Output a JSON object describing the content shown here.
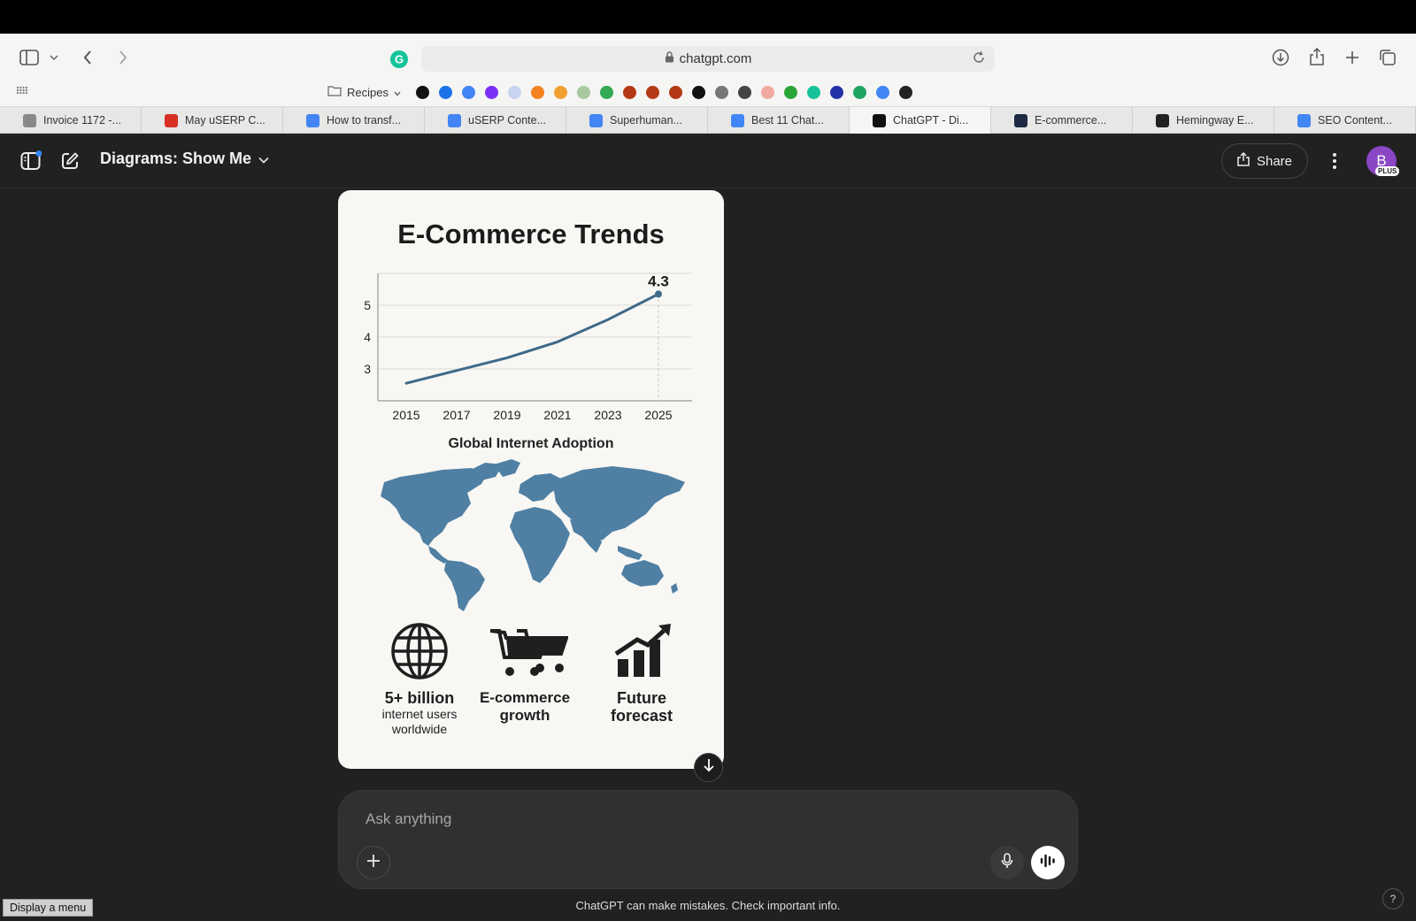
{
  "browser": {
    "url": "chatgpt.com",
    "bookmarks_folder": "Recipes",
    "favicons": [
      {
        "name": "apple-favicon",
        "color": "#111111"
      },
      {
        "name": "search-favicon",
        "color": "#1a73e8"
      },
      {
        "name": "google-favicon",
        "color": "#4285f4"
      },
      {
        "name": "slash-favicon",
        "color": "#7b2ff7"
      },
      {
        "name": "pen-favicon",
        "color": "#c7d4ef"
      },
      {
        "name": "orange-favicon",
        "color": "#f58220"
      },
      {
        "name": "stripe-favicon",
        "color": "#f0a030"
      },
      {
        "name": "quill-favicon",
        "color": "#a8c8a0"
      },
      {
        "name": "google2-favicon",
        "color": "#34a853"
      },
      {
        "name": "burger1-favicon",
        "color": "#b33a14"
      },
      {
        "name": "burger2-favicon",
        "color": "#b33a14"
      },
      {
        "name": "burger3-favicon",
        "color": "#b33a14"
      },
      {
        "name": "t-favicon",
        "color": "#111111"
      },
      {
        "name": "globe-favicon",
        "color": "#777777"
      },
      {
        "name": "ms-favicon",
        "color": "#444444"
      },
      {
        "name": "hand-favicon",
        "color": "#f2a9a0"
      },
      {
        "name": "green-square-favicon",
        "color": "#2aa639"
      },
      {
        "name": "grammarly-favicon",
        "color": "#15c39a"
      },
      {
        "name": "c-favicon",
        "color": "#2233aa"
      },
      {
        "name": "sheets-favicon",
        "color": "#1fa463"
      },
      {
        "name": "docs-favicon",
        "color": "#4285f4"
      },
      {
        "name": "h-favicon",
        "color": "#222222"
      }
    ]
  },
  "tabs": [
    {
      "label": "Invoice 1172 -...",
      "icon_color": "#888888"
    },
    {
      "label": "May uSERP C...",
      "icon_color": "#d93025"
    },
    {
      "label": "How to transf...",
      "icon_color": "#4285f4"
    },
    {
      "label": "uSERP Conte...",
      "icon_color": "#4285f4"
    },
    {
      "label": "Superhuman...",
      "icon_color": "#4285f4"
    },
    {
      "label": "Best 11 Chat...",
      "icon_color": "#4285f4"
    },
    {
      "label": "ChatGPT - Di...",
      "icon_color": "#111111",
      "active": true
    },
    {
      "label": "E-commerce...",
      "icon_color": "#1e2a44"
    },
    {
      "label": "Hemingway E...",
      "icon_color": "#222222"
    },
    {
      "label": "SEO Content...",
      "icon_color": "#4285f4"
    }
  ],
  "app": {
    "model_label": "Diagrams: Show Me",
    "share_label": "Share",
    "avatar_initial": "B",
    "plan_badge": "PLUS"
  },
  "card": {
    "title": "E-Commerce Trends",
    "map_title": "Global Internet Adoption",
    "stats": [
      {
        "big": "5+ billion",
        "small": "internet users worldwide"
      },
      {
        "big": "E-commerce growth",
        "small": ""
      },
      {
        "big": "Future forecast",
        "small": ""
      }
    ]
  },
  "chart_data": {
    "type": "line",
    "x": [
      2015,
      2017,
      2019,
      2021,
      2023,
      2025
    ],
    "y": [
      2.55,
      2.95,
      3.35,
      3.85,
      4.55,
      5.35
    ],
    "x_ticks": [
      "2015",
      "2017",
      "2019",
      "2021",
      "2023",
      "2025"
    ],
    "y_ticks": [
      "3",
      "4",
      "5"
    ],
    "ylim": [
      2.0,
      6.0
    ],
    "annotation": "4.3",
    "color": "#3f6a8a",
    "grid": true
  },
  "composer": {
    "placeholder": "Ask anything"
  },
  "footer": {
    "disclaimer": "ChatGPT can make mistakes. Check important info.",
    "display_menu": "Display a menu",
    "help": "?"
  }
}
